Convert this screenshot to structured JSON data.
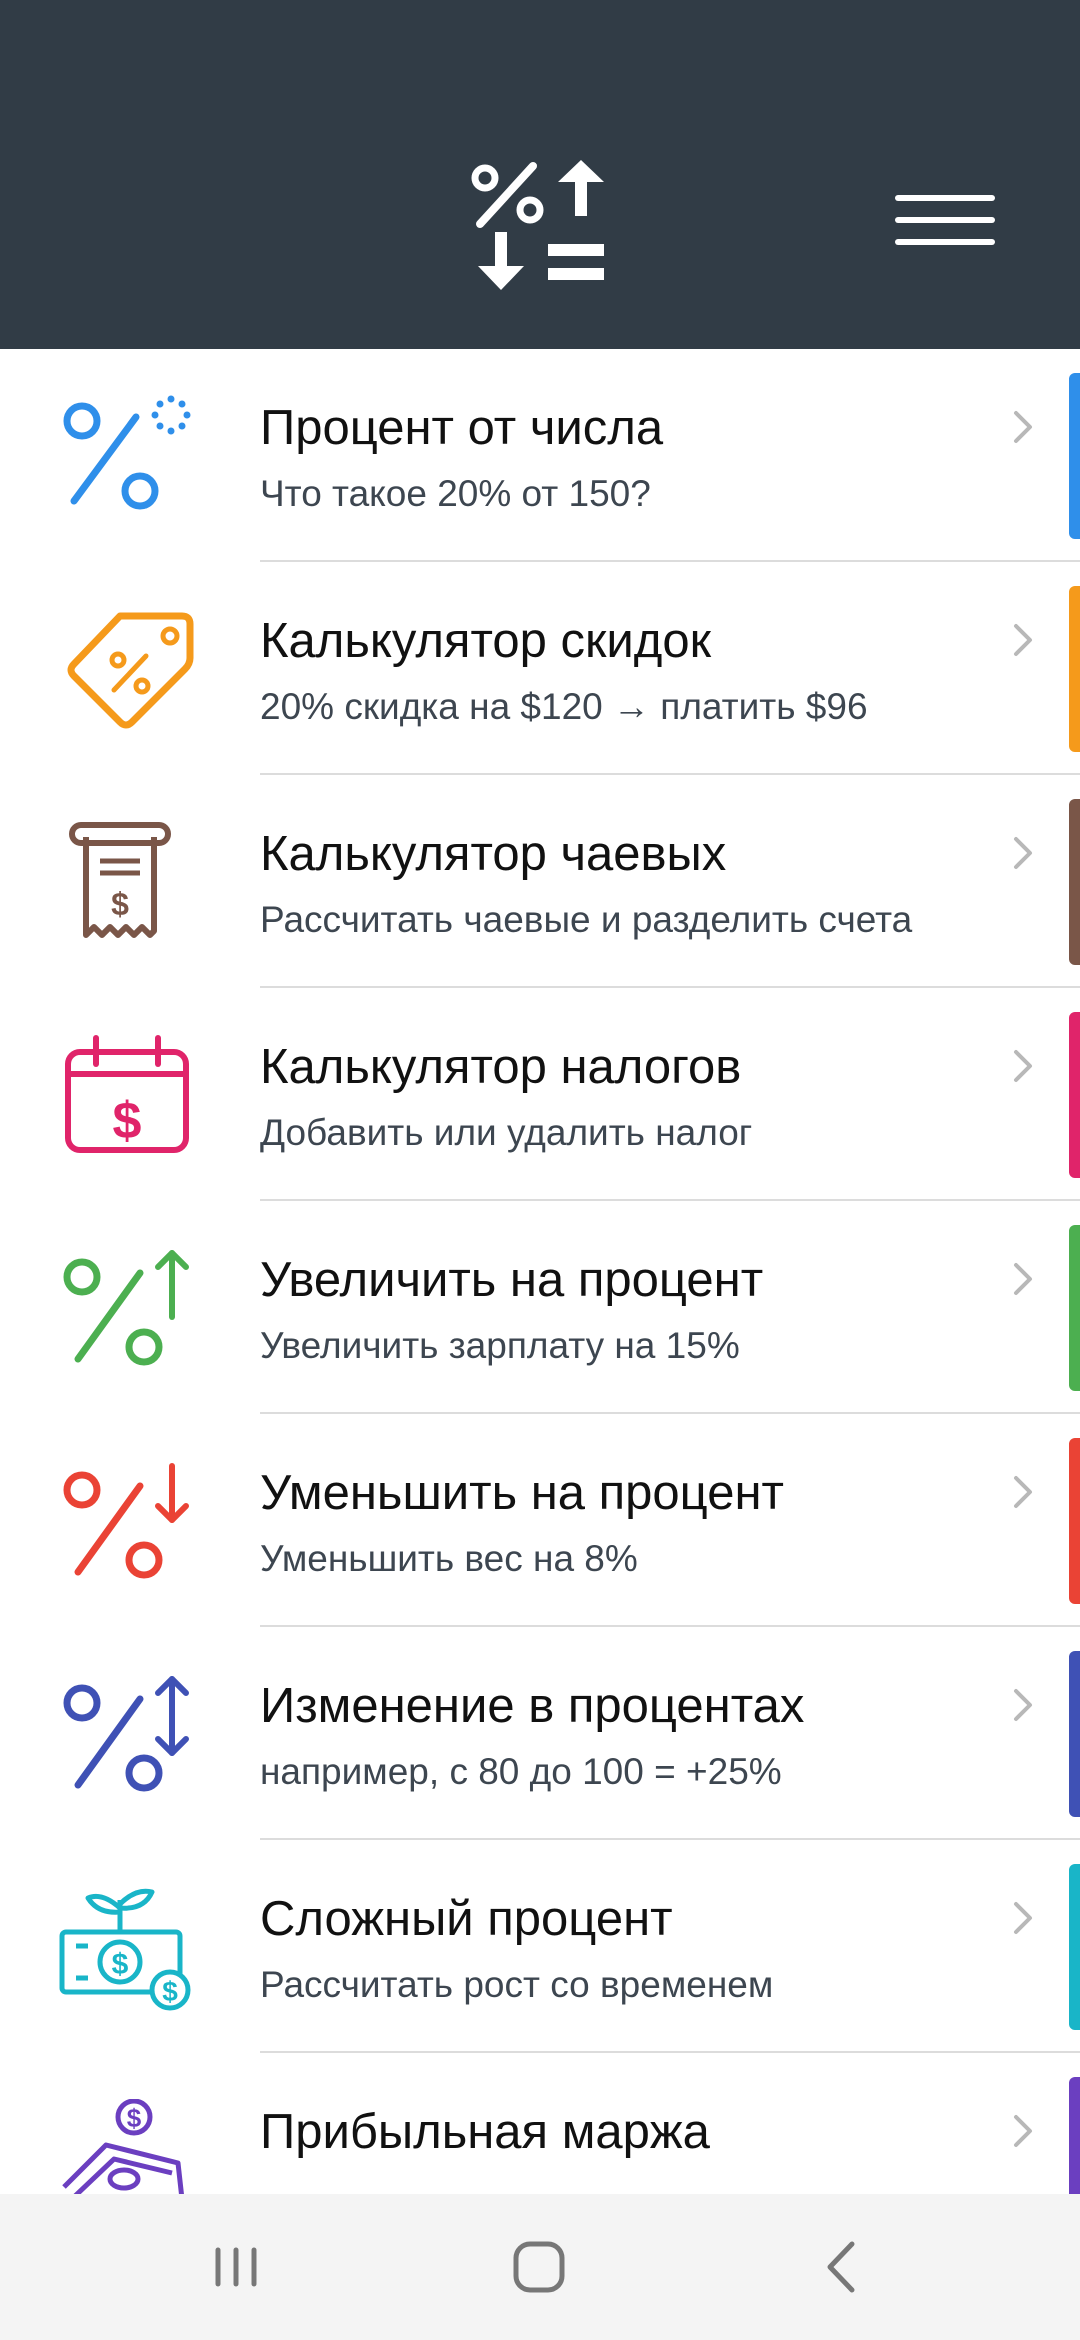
{
  "header": {
    "logo_icon": "percent-arrows-logo-icon",
    "menu_icon": "hamburger-menu-icon",
    "background": "#313C46"
  },
  "items": [
    {
      "title": "Процент от числа",
      "subtitle": "Что такое 20% от 150?",
      "icon": "percent-dots-icon",
      "color": "#2F8FEA"
    },
    {
      "title": "Калькулятор скидок",
      "subtitle": "20% скидка на $120 → платить $96",
      "icon": "discount-tag-icon",
      "color": "#F59A1B"
    },
    {
      "title": "Калькулятор чаевых",
      "subtitle": "Рассчитать чаевые и разделить счета",
      "icon": "receipt-icon",
      "color": "#7A5648"
    },
    {
      "title": "Калькулятор налогов",
      "subtitle": "Добавить или удалить налог",
      "icon": "tax-calendar-icon",
      "color": "#E0246A"
    },
    {
      "title": "Увеличить на процент",
      "subtitle": "Увеличить зарплату на 15%",
      "icon": "percent-arrow-up-icon",
      "color": "#4CAF50"
    },
    {
      "title": "Уменьшить на процент",
      "subtitle": "Уменьшить вес на 8%",
      "icon": "percent-arrow-down-icon",
      "color": "#EA4335"
    },
    {
      "title": "Изменение в процентах",
      "subtitle": "например, с 80 до 100 = +25%",
      "icon": "percent-arrows-updown-icon",
      "color": "#3F51B5"
    },
    {
      "title": "Сложный процент",
      "subtitle": "Рассчитать рост со временем",
      "icon": "money-plant-icon",
      "color": "#19B5C8"
    },
    {
      "title": "Прибыльная маржа",
      "subtitle": "",
      "icon": "profit-money-icon",
      "color": "#6B3FC0"
    }
  ],
  "navbar": {
    "recent_icon": "recent-apps-icon",
    "home_icon": "home-icon",
    "back_icon": "back-icon"
  }
}
